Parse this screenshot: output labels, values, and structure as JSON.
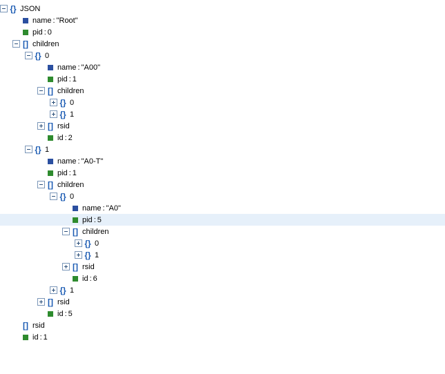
{
  "root_label": "JSON",
  "keys": {
    "name": "name",
    "pid": "pid",
    "children": "children",
    "rsid": "rsid",
    "id": "id"
  },
  "root": {
    "name": "\"Root\"",
    "pid": "0",
    "id": "1"
  },
  "c0": {
    "idx": "0",
    "name": "\"A00\"",
    "pid": "1",
    "id": "2",
    "child0": "0",
    "child1": "1"
  },
  "c1": {
    "idx": "1",
    "name": "\"A0-T\"",
    "pid": "1",
    "id": "5",
    "child1": "1",
    "c0": {
      "idx": "0",
      "name": "\"A0\"",
      "pid": "5",
      "id": "6",
      "child0": "0",
      "child1": "1"
    }
  }
}
